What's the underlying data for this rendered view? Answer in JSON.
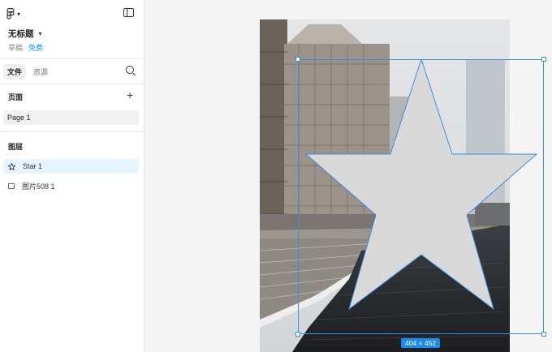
{
  "sidebar": {
    "file_title": "无标题",
    "meta": {
      "draft": "草稿",
      "plan": "免费"
    },
    "tabs": [
      {
        "label": "文件",
        "active": true
      },
      {
        "label": "资源",
        "active": false
      }
    ],
    "pages_title": "页面",
    "pages": [
      "Page 1"
    ],
    "layers_title": "图层",
    "layers": [
      {
        "label": "Star 1",
        "icon": "star-icon",
        "selected": true
      },
      {
        "label": "图片508 1",
        "icon": "image-icon",
        "selected": false
      }
    ]
  },
  "canvas": {
    "selection_size": "404 × 452"
  },
  "colors": {
    "accent": "#0d99ff",
    "selection": "#3b8fe0",
    "star_fill": "#d9d9d9"
  }
}
